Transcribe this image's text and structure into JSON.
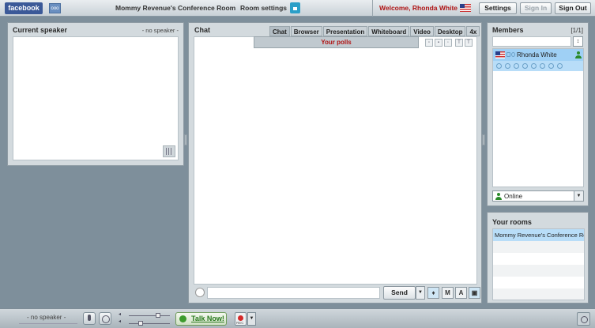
{
  "header": {
    "facebook_label": "facebook",
    "room_title": "Mommy Revenue's Conference Room",
    "room_settings_label": "Room settings",
    "welcome": "Welcome, Rhonda White",
    "settings_label": "Settings",
    "sign_in_label": "Sign In",
    "sign_out_label": "Sign Out"
  },
  "speaker": {
    "title": "Current speaker",
    "status": "- no speaker -"
  },
  "chat": {
    "title": "Chat",
    "tabs": [
      "Chat",
      "Browser",
      "Presentation",
      "Whiteboard",
      "Video",
      "Desktop",
      "4x"
    ],
    "active_tab": "Chat",
    "polls_label": "Your polls",
    "send_label": "Send",
    "input_placeholder": ""
  },
  "members": {
    "title": "Members",
    "count": "[1/1]",
    "list": [
      {
        "name": "Rhonda White"
      }
    ],
    "status_label": "Online"
  },
  "rooms": {
    "title": "Your rooms",
    "list": [
      "Mommy Revenue's Conference Roo"
    ]
  },
  "bottom": {
    "speaker_status": "- no speaker -",
    "talk_label": "Talk Now!",
    "rec_label": "REC"
  },
  "colors": {
    "accent_red": "#b01515",
    "facebook_blue": "#3b5998",
    "selection_blue": "#9fd0f5",
    "talk_green": "#2a7a1f"
  }
}
